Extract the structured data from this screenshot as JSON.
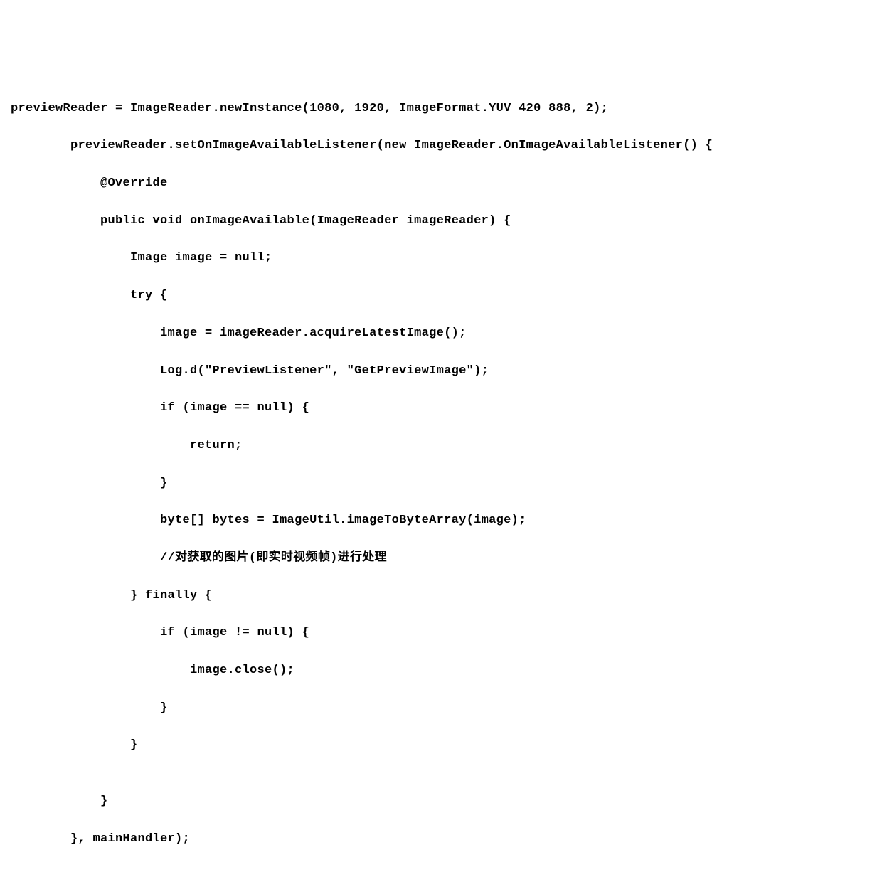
{
  "code": {
    "lines": [
      "previewReader = ImageReader.newInstance(1080, 1920, ImageFormat.YUV_420_888, 2);",
      "        previewReader.setOnImageAvailableListener(new ImageReader.OnImageAvailableListener() {",
      "            @Override",
      "            public void onImageAvailable(ImageReader imageReader) {",
      "                Image image = null;",
      "                try {",
      "                    image = imageReader.acquireLatestImage();",
      "                    Log.d(\"PreviewListener\", \"GetPreviewImage\");",
      "                    if (image == null) {",
      "                        return;",
      "                    }",
      "                    byte[] bytes = ImageUtil.imageToByteArray(image);",
      "                    //对获取的图片(即实时视频帧)进行处理",
      "                } finally {",
      "                    if (image != null) {",
      "                        image.close();",
      "                    }",
      "                }",
      "",
      "            }",
      "        }, mainHandler);"
    ]
  }
}
